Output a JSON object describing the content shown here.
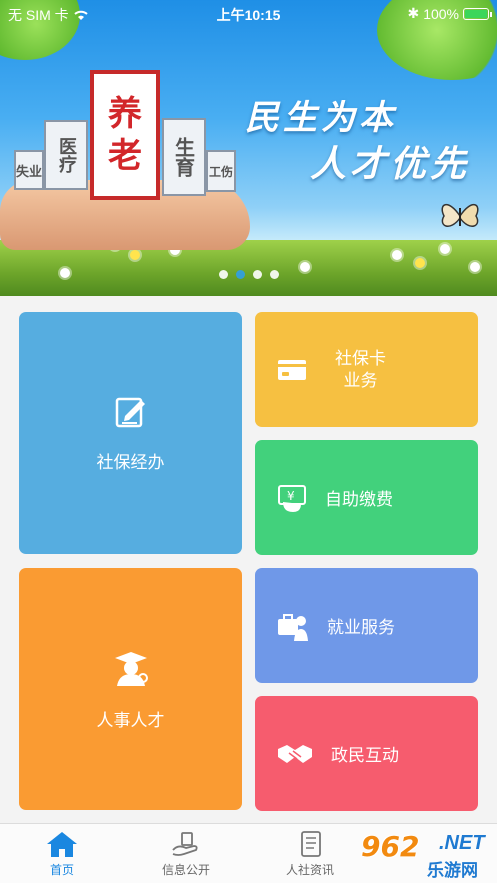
{
  "status_bar": {
    "carrier": "无 SIM 卡",
    "time": "上午10:15",
    "battery": "100%",
    "battery_level": 1.0
  },
  "banner": {
    "slogan_line1": "民生为本",
    "slogan_line2": "人才优先",
    "house_center": [
      "养",
      "老"
    ],
    "house_left1": "医疗",
    "house_left2": "失业",
    "house_right1": "生育",
    "house_right2": "工伤",
    "page_count": 4,
    "active_page": 1
  },
  "tiles": {
    "social_security": {
      "label": "社保经办",
      "color": "#56ade0",
      "icon": "edit-document-icon"
    },
    "card_business": {
      "label_line1": "社保卡",
      "label_line2": "业务",
      "color": "#f6c041",
      "icon": "card-icon"
    },
    "self_payment": {
      "label": "自助缴费",
      "color": "#42d17c",
      "icon": "yuan-payment-icon"
    },
    "hr_talent": {
      "label": "人事人才",
      "color": "#fa9b32",
      "icon": "graduate-icon"
    },
    "employment": {
      "label": "就业服务",
      "color": "#6f98e8",
      "icon": "briefcase-person-icon"
    },
    "interaction": {
      "label": "政民互动",
      "color": "#f65c6e",
      "icon": "handshake-icon"
    }
  },
  "tab_bar": {
    "items": [
      {
        "label": "首页",
        "icon": "home-icon",
        "active": true
      },
      {
        "label": "信息公开",
        "icon": "hand-info-icon",
        "active": false
      },
      {
        "label": "人社资讯",
        "icon": "news-icon",
        "active": false
      }
    ],
    "accent": "#1a87e0"
  },
  "watermark": {
    "number": "962",
    "net": ".NET",
    "brand": "乐游网"
  }
}
